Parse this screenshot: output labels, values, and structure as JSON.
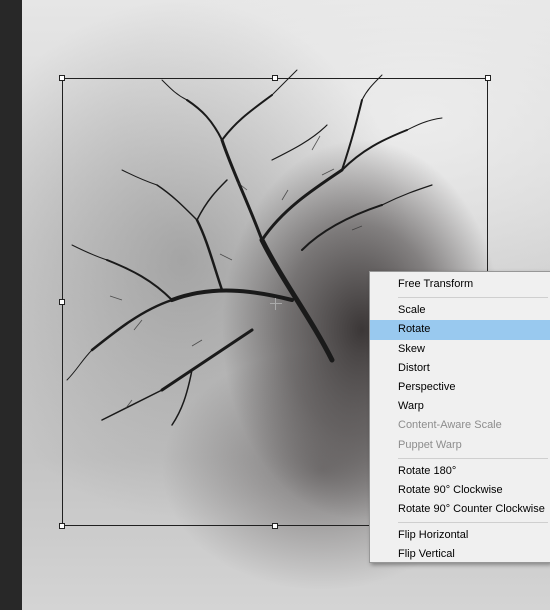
{
  "context_menu": {
    "groups": [
      [
        {
          "label": "Free Transform",
          "state": "normal"
        }
      ],
      [
        {
          "label": "Scale",
          "state": "normal"
        },
        {
          "label": "Rotate",
          "state": "highlighted"
        },
        {
          "label": "Skew",
          "state": "normal"
        },
        {
          "label": "Distort",
          "state": "normal"
        },
        {
          "label": "Perspective",
          "state": "normal"
        },
        {
          "label": "Warp",
          "state": "normal"
        },
        {
          "label": "Content-Aware Scale",
          "state": "disabled"
        },
        {
          "label": "Puppet Warp",
          "state": "disabled"
        }
      ],
      [
        {
          "label": "Rotate 180°",
          "state": "normal"
        },
        {
          "label": "Rotate 90° Clockwise",
          "state": "normal"
        },
        {
          "label": "Rotate 90° Counter Clockwise",
          "state": "normal"
        }
      ],
      [
        {
          "label": "Flip Horizontal",
          "state": "normal"
        },
        {
          "label": "Flip Vertical",
          "state": "normal"
        }
      ]
    ]
  },
  "colors": {
    "menu_background": "#f0f0f0",
    "menu_highlight": "#99c9ef",
    "disabled_text": "#8d8d8d"
  },
  "icons": {
    "transform_center": "crosshair-icon"
  }
}
